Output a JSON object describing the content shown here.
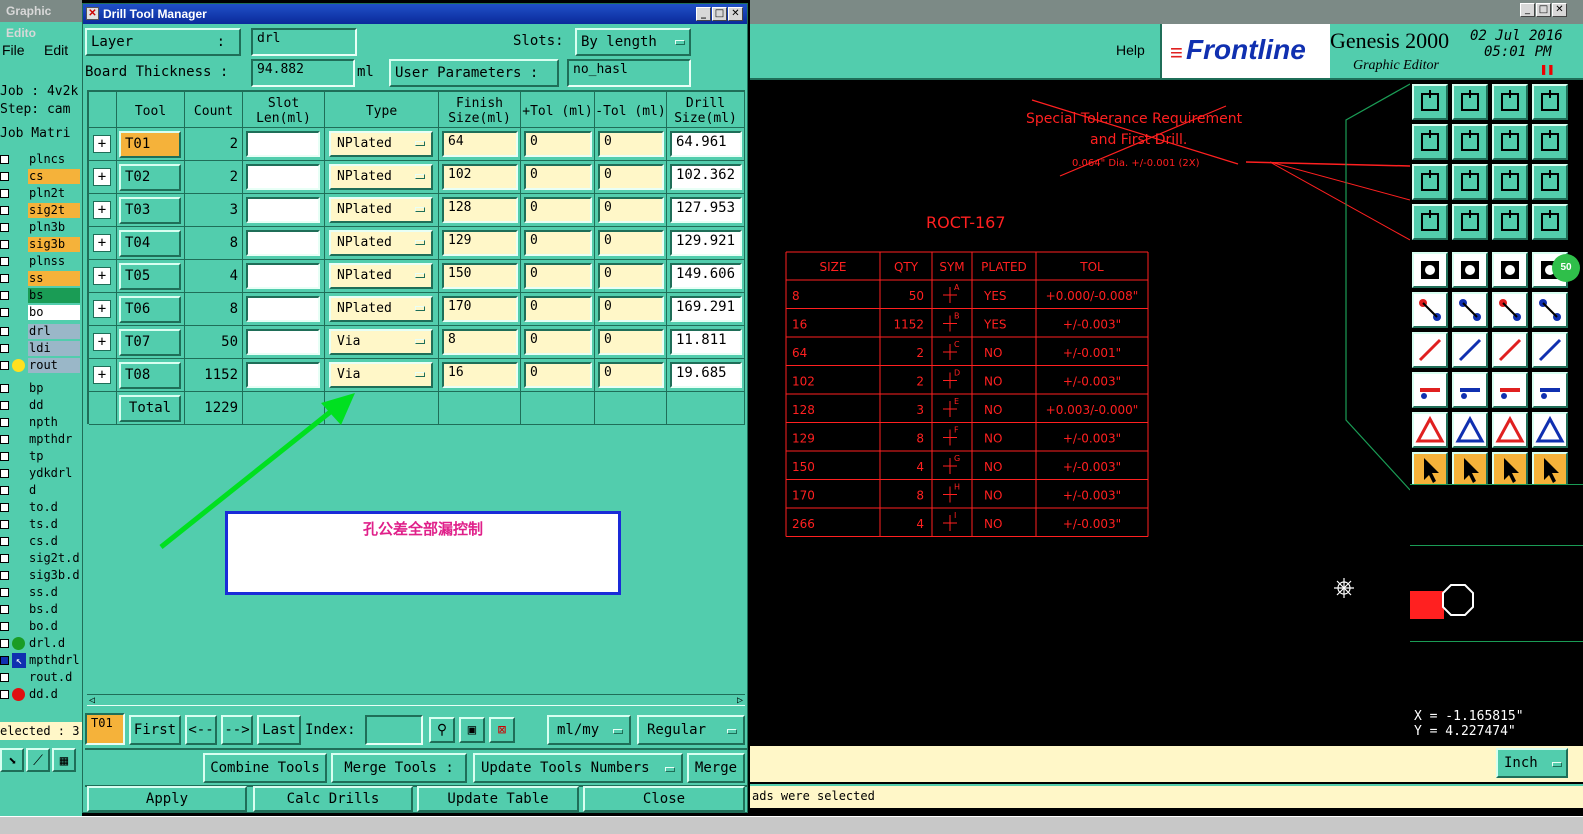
{
  "left_window": {
    "title": "Graphic Edito",
    "menu": [
      "File",
      "Edit"
    ],
    "job_label": "Job : 4v2k",
    "step_label": "Step: cam",
    "matrix_label": "Job Matri",
    "layers": [
      {
        "name": "plncs",
        "bg": "#52cdad",
        "mark": "box"
      },
      {
        "name": "cs",
        "bg": "#f5b23a",
        "mark": "box"
      },
      {
        "name": "pln2t",
        "bg": "#52cdad",
        "mark": "box"
      },
      {
        "name": "sig2t",
        "bg": "#f5b23a",
        "mark": "box"
      },
      {
        "name": "pln3b",
        "bg": "#52cdad",
        "mark": "box"
      },
      {
        "name": "sig3b",
        "bg": "#f5b23a",
        "mark": "box"
      },
      {
        "name": "plnss",
        "bg": "#52cdad",
        "mark": "box"
      },
      {
        "name": "ss",
        "bg": "#f5b23a",
        "mark": "box"
      },
      {
        "name": "bs",
        "bg": "#1a9c55",
        "mark": "box"
      },
      {
        "name": "bo",
        "bg": "#ffffff",
        "mark": "box"
      },
      {
        "name": "drl",
        "bg": "#9ab7c8",
        "mark": "box"
      },
      {
        "name": "ldi",
        "bg": "#9ab7c8",
        "mark": "box"
      },
      {
        "name": "rout",
        "bg": "#9ab7c8",
        "mark": "yellow-dot"
      },
      {
        "name": "bp",
        "bg": "#52cdad",
        "mark": "box"
      },
      {
        "name": "dd",
        "bg": "#52cdad",
        "mark": "box"
      },
      {
        "name": "npth",
        "bg": "#52cdad",
        "mark": "box"
      },
      {
        "name": "mpthdr",
        "bg": "#52cdad",
        "mark": "box"
      },
      {
        "name": "tp",
        "bg": "#52cdad",
        "mark": "box"
      },
      {
        "name": "ydkdrl",
        "bg": "#52cdad",
        "mark": "box"
      },
      {
        "name": "d",
        "bg": "#52cdad",
        "mark": "box"
      },
      {
        "name": "to.d",
        "bg": "#52cdad",
        "mark": "box"
      },
      {
        "name": "ts.d",
        "bg": "#52cdad",
        "mark": "box"
      },
      {
        "name": "cs.d",
        "bg": "#52cdad",
        "mark": "box"
      },
      {
        "name": "sig2t.d",
        "bg": "#52cdad",
        "mark": "box"
      },
      {
        "name": "sig3b.d",
        "bg": "#52cdad",
        "mark": "box"
      },
      {
        "name": "ss.d",
        "bg": "#52cdad",
        "mark": "box"
      },
      {
        "name": "bs.d",
        "bg": "#52cdad",
        "mark": "box"
      },
      {
        "name": "bo.d",
        "bg": "#52cdad",
        "mark": "box"
      },
      {
        "name": "drl.d",
        "bg": "#52cdad",
        "mark": "green-dot"
      },
      {
        "name": "mpthdrl",
        "bg": "#52cdad",
        "mark": "arrow"
      },
      {
        "name": "rout.d",
        "bg": "#52cdad",
        "mark": "box"
      },
      {
        "name": "dd.d",
        "bg": "#52cdad",
        "mark": "red-dot"
      }
    ],
    "selected_label": "elected : 3"
  },
  "dtm": {
    "title": "Drill Tool Manager",
    "layer_label": "Layer",
    "layer_colon": ":",
    "layer_value": "drl",
    "slots_label": "Slots:",
    "slots_value": "By length",
    "thickness_label": "Board Thickness :",
    "thickness_value": "94.882",
    "thickness_unit": "ml",
    "user_params_label": "User Parameters :",
    "user_params_value": "no_hasl",
    "headers": [
      "Tool",
      "Count",
      "Slot Len(ml)",
      "Type",
      "Finish Size(ml)",
      "+Tol (ml)",
      "-Tol (ml)",
      "Drill Size(ml)"
    ],
    "rows": [
      {
        "tool": "T01",
        "count": "2",
        "type": "NPlated",
        "finish": "64",
        "ptol": "0",
        "ntol": "0",
        "drill": "64.961",
        "highlight": true
      },
      {
        "tool": "T02",
        "count": "2",
        "type": "NPlated",
        "finish": "102",
        "ptol": "0",
        "ntol": "0",
        "drill": "102.362",
        "highlight": false
      },
      {
        "tool": "T03",
        "count": "3",
        "type": "NPlated",
        "finish": "128",
        "ptol": "0",
        "ntol": "0",
        "drill": "127.953",
        "highlight": false
      },
      {
        "tool": "T04",
        "count": "8",
        "type": "NPlated",
        "finish": "129",
        "ptol": "0",
        "ntol": "0",
        "drill": "129.921",
        "highlight": false
      },
      {
        "tool": "T05",
        "count": "4",
        "type": "NPlated",
        "finish": "150",
        "ptol": "0",
        "ntol": "0",
        "drill": "149.606",
        "highlight": false
      },
      {
        "tool": "T06",
        "count": "8",
        "type": "NPlated",
        "finish": "170",
        "ptol": "0",
        "ntol": "0",
        "drill": "169.291",
        "highlight": false
      },
      {
        "tool": "T07",
        "count": "50",
        "type": "Via",
        "finish": "8",
        "ptol": "0",
        "ntol": "0",
        "drill": "11.811",
        "highlight": false
      },
      {
        "tool": "T08",
        "count": "1152",
        "type": "Via",
        "finish": "16",
        "ptol": "0",
        "ntol": "0",
        "drill": "19.685",
        "highlight": false
      }
    ],
    "total_label": "Total",
    "total_value": "1229",
    "annotation_text": "孔公差全部漏控制",
    "nav": {
      "current": "T01",
      "first": "First",
      "prev": "<--",
      "next": "-->",
      "last": "Last",
      "index_label": "Index:",
      "units": "ml/my",
      "mode": "Regular"
    },
    "actions": {
      "combine": "Combine Tools",
      "merge_label": "Merge Tools :",
      "update_numbers": "Update Tools Numbers",
      "merge": "Merge"
    },
    "bottom": {
      "apply": "Apply",
      "calc": "Calc Drills",
      "update_table": "Update Table",
      "close": "Close"
    }
  },
  "right_window": {
    "help": "Help",
    "brand": "Frontline",
    "product": "Genesis 2000",
    "subtitle": "Graphic Editor",
    "date": "02 Jul 2016",
    "time": "05:01 PM",
    "badge": "50",
    "x_readout": "X = -1.165815\"",
    "y_readout": "Y = 4.227474\"",
    "units": "Inch",
    "status": "ads were selected"
  },
  "canvas": {
    "note_line1": "Special Tolerance Requirement",
    "note_line2": "and First Drill.",
    "note_line3": "0.064\" Dia. +/-0.001 (2X)",
    "table_title": "ROCT-167",
    "headers": [
      "SIZE",
      "QTY",
      "SYM",
      "PLATED",
      "TOL"
    ],
    "rows": [
      [
        "8",
        "50",
        "A",
        "YES",
        "+0.000/-0.008\""
      ],
      [
        "16",
        "1152",
        "B",
        "YES",
        "+/-0.003\""
      ],
      [
        "64",
        "2",
        "C",
        "NO",
        "+/-0.001\""
      ],
      [
        "102",
        "2",
        "D",
        "NO",
        "+/-0.003\""
      ],
      [
        "128",
        "3",
        "E",
        "NO",
        "+0.003/-0.000\""
      ],
      [
        "129",
        "8",
        "F",
        "NO",
        "+/-0.003\""
      ],
      [
        "150",
        "4",
        "G",
        "NO",
        "+/-0.003\""
      ],
      [
        "170",
        "8",
        "H",
        "NO",
        "+/-0.003\""
      ],
      [
        "266",
        "4",
        "I",
        "NO",
        "+/-0.003\""
      ]
    ]
  }
}
